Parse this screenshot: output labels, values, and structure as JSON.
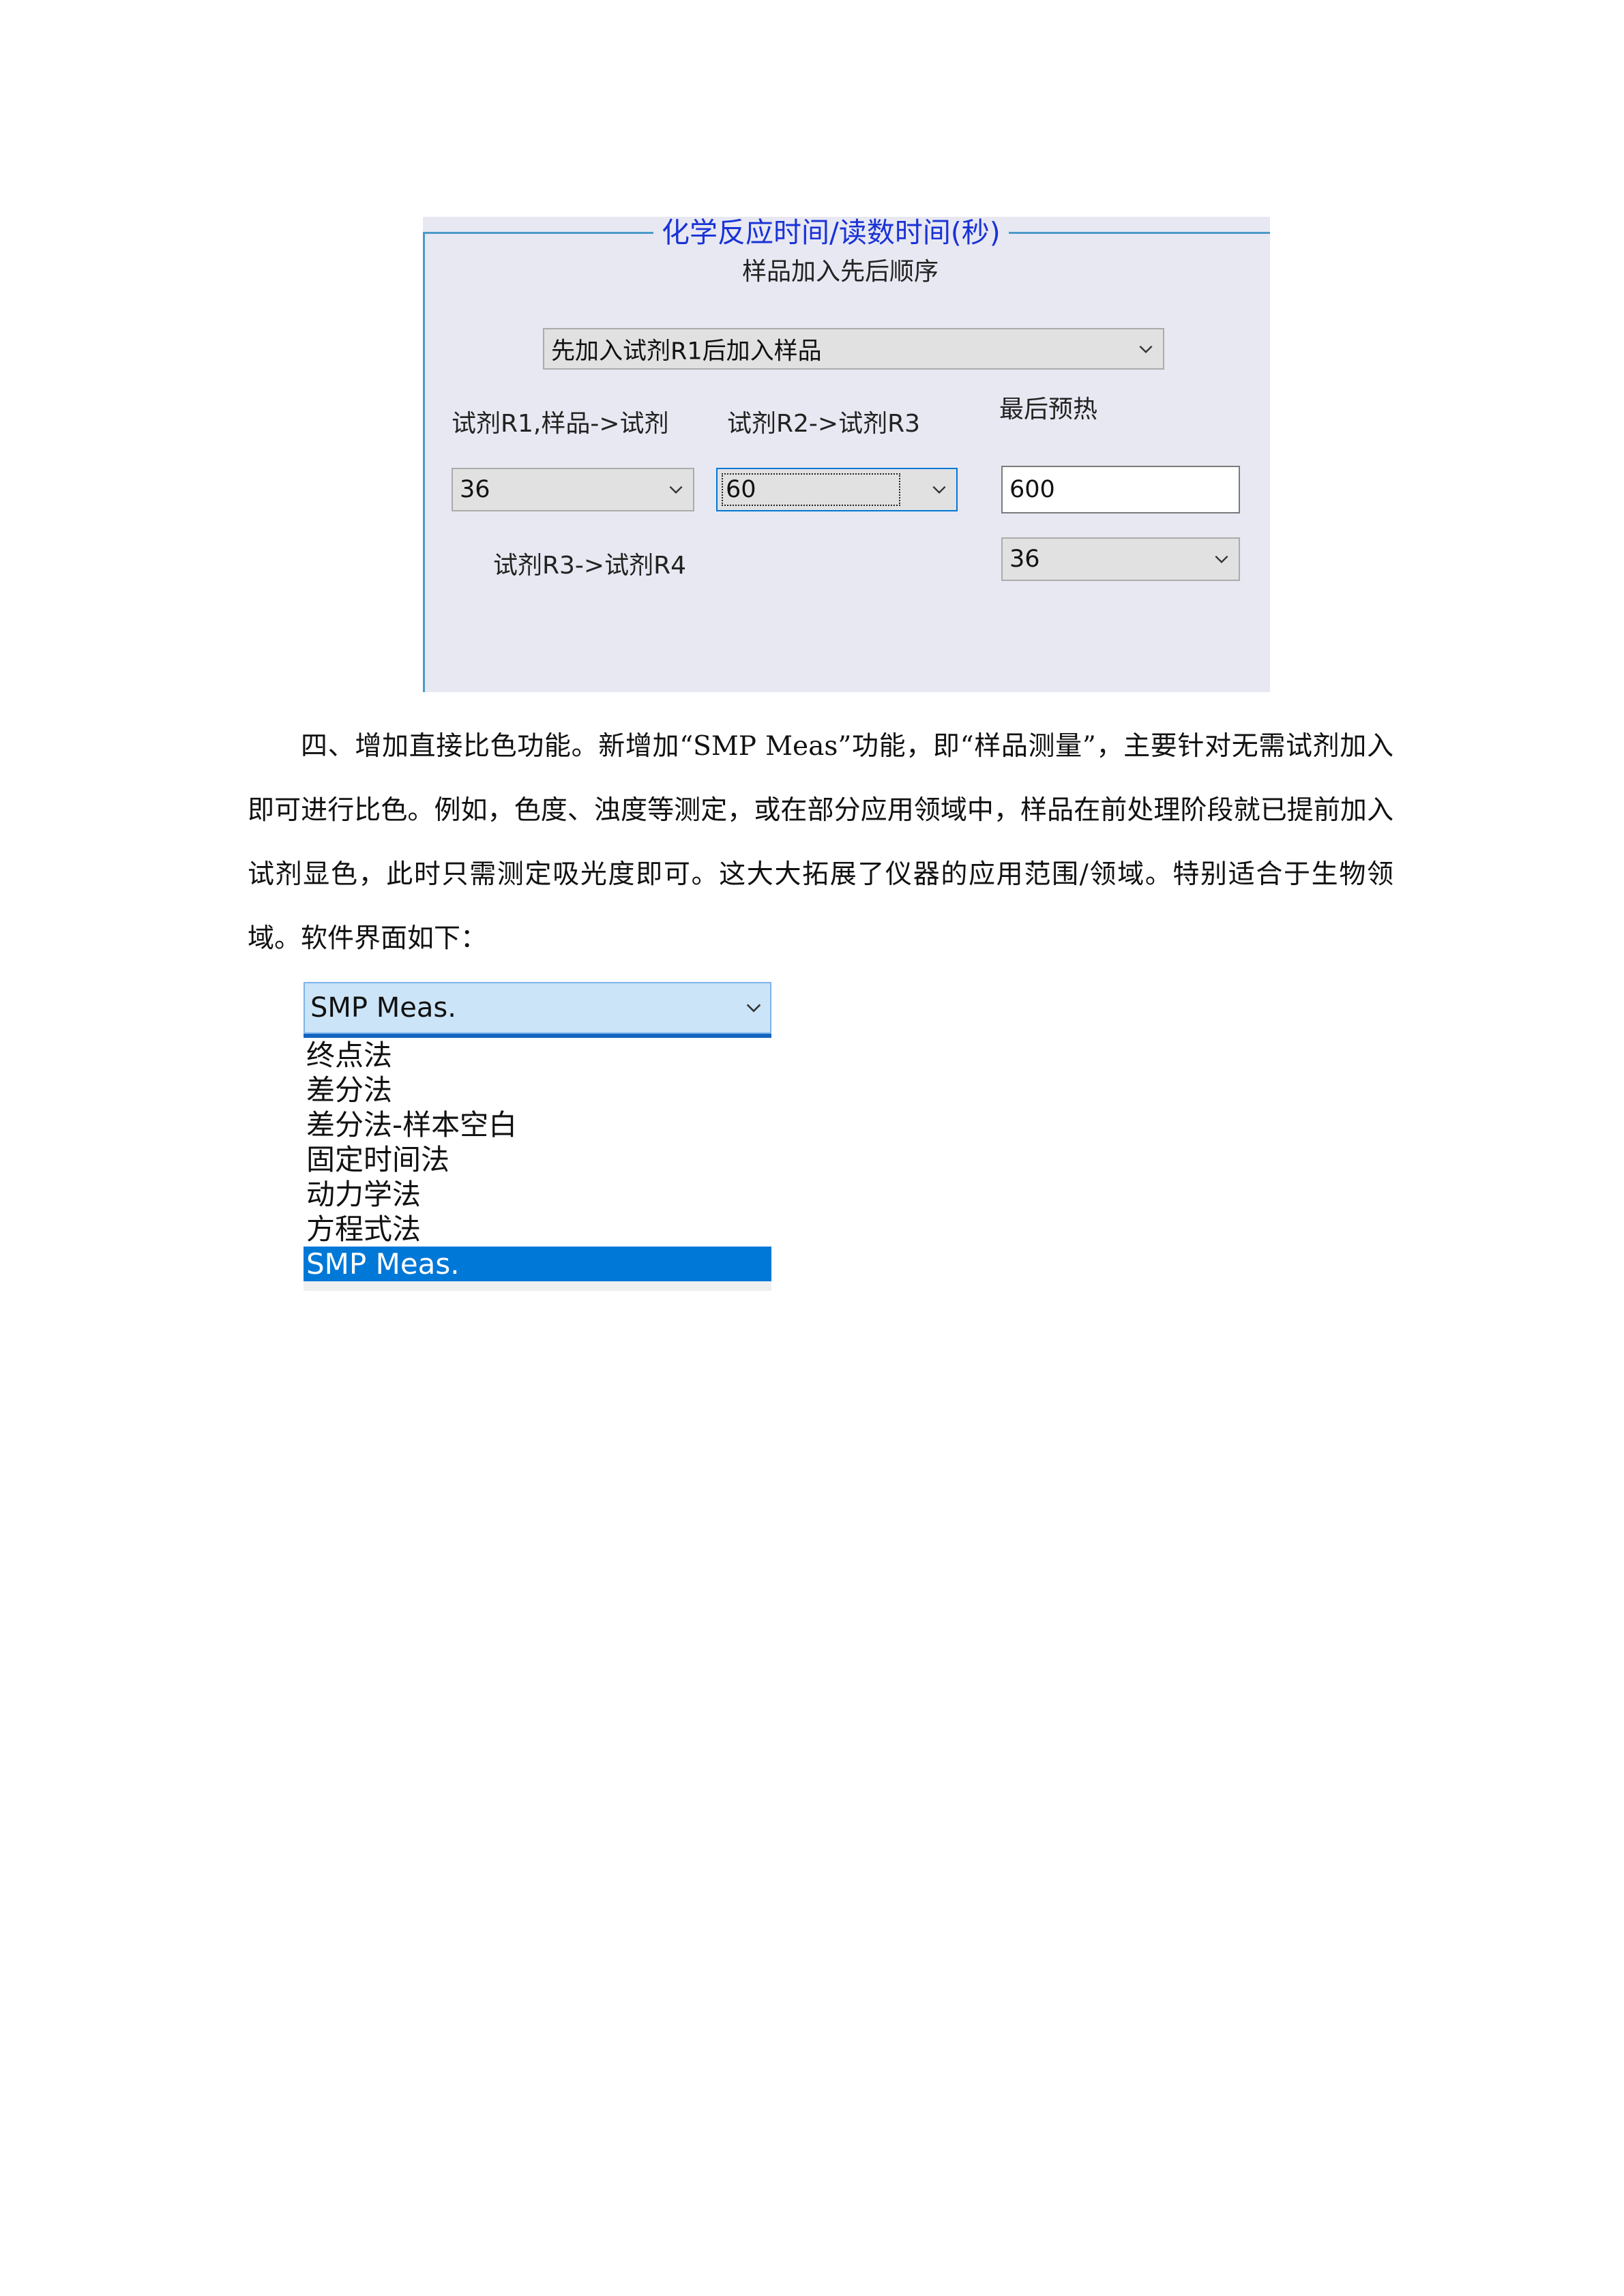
{
  "panel": {
    "legend": "化学反应时间/读数时间(秒)",
    "order_label": "样品加入先后顺序",
    "order_value": "先加入试剂R1后加入样品",
    "r1_label": "试剂R1,样品->试剂",
    "r1_value": "36",
    "r2_label": "试剂R2->试剂R3",
    "r2_value": "60",
    "preheat_label": "最后预热",
    "preheat_value": "600",
    "r3_label": "试剂R3->试剂R4",
    "r3_value": "36"
  },
  "paragraph": "四、增加直接比色功能。新增加“SMP Meas”功能，即“样品测量”，主要针对无需试剂加入即可进行比色。例如，色度、浊度等测定，或在部分应用领域中，样品在前处理阶段就已提前加入试剂显色，此时只需测定吸光度即可。这大大拓展了仪器的应用范围/领域。特别适合于生物领域。软件界面如下：",
  "dropdown": {
    "selected": "SMP Meas.",
    "options": [
      "终点法",
      "差分法",
      "差分法-样本空白",
      "固定时间法",
      "动力学法",
      "方程式法",
      "SMP Meas."
    ],
    "highlighted_index": 6
  },
  "colors": {
    "legend_text": "#1a33d6",
    "groupbox_line": "#4a9ac9",
    "selection": "#0078d7",
    "dropdown_head": "#cce4f7"
  },
  "icons": {
    "combo_arrow": "chevron-down-icon"
  }
}
